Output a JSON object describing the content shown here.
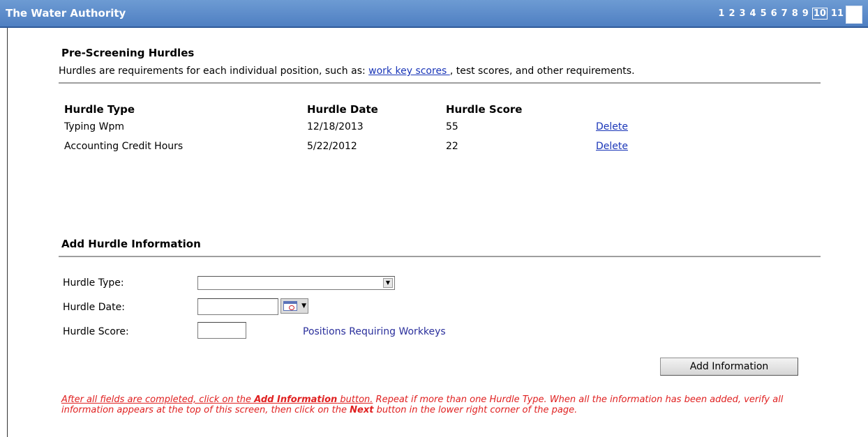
{
  "header": {
    "app_title": "The Water Authority",
    "pages": [
      "1",
      "2",
      "3",
      "4",
      "5",
      "6",
      "7",
      "8",
      "9",
      "10",
      "11"
    ],
    "current_page": "10"
  },
  "prescreen": {
    "title": "Pre-Screening Hurdles",
    "desc_before": "Hurdles are requirements for each individual position, such as: ",
    "desc_link": "work key scores ",
    "desc_after": ", test scores, and other requirements."
  },
  "table": {
    "headers": {
      "type": "Hurdle Type",
      "date": "Hurdle Date",
      "score": "Hurdle Score"
    },
    "rows": [
      {
        "type": "Typing Wpm",
        "date": "12/18/2013",
        "score": "55",
        "action": "Delete"
      },
      {
        "type": "Accounting Credit Hours",
        "date": "5/22/2012",
        "score": "22",
        "action": "Delete"
      }
    ]
  },
  "add_form": {
    "title": "Add Hurdle Information",
    "type_label": "Hurdle Type:",
    "date_label": "Hurdle Date:",
    "score_label": "Hurdle Score:",
    "type_value": "",
    "date_value": "",
    "score_value": "",
    "workkeys_link": "Positions Requiring Workkeys",
    "add_button": "Add Information"
  },
  "instructions": {
    "part1": "After all fields are completed, click on the ",
    "part2": "Add Information",
    "part3": " button.",
    "part4": " Repeat if more than one Hurdle Type. When all the information has been added, verify all information appears at the top of this screen, then click on the ",
    "part5": "Next",
    "part6": " button in the lower right corner of the page."
  },
  "colors": {
    "header_bg": "#5a8acb",
    "link": "#1a36b8",
    "instruction_text": "#e02020"
  }
}
